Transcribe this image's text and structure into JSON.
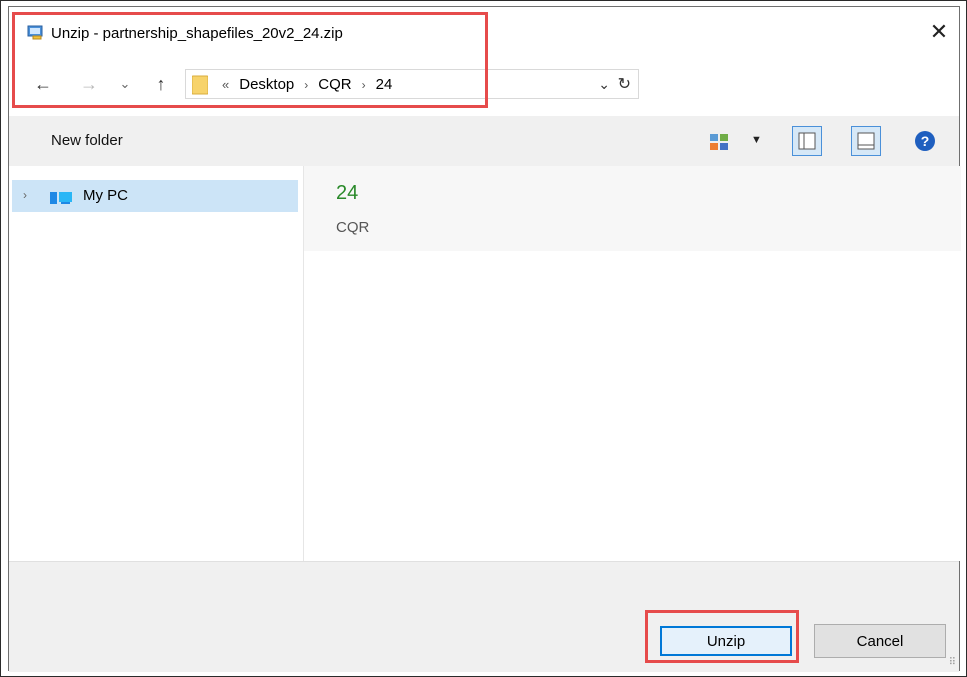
{
  "window": {
    "title": "Unzip - partnership_shapefiles_20v2_24.zip",
    "close_glyph": "✕",
    "title_icon": "unzip-app-icon"
  },
  "nav": {
    "back_glyph": "←",
    "forward_glyph": "→",
    "recent_glyph": "⌄",
    "up_glyph": "↑",
    "overflow_glyph": "«",
    "crumbs": [
      "Desktop",
      "CQR",
      "24"
    ],
    "separator": "›",
    "dropdown_glyph": "⌄",
    "refresh_glyph": "↻"
  },
  "commandbar": {
    "new_folder_label": "New folder",
    "view_drop_glyph": "▼",
    "help_glyph": "?"
  },
  "tree": {
    "items": [
      {
        "label": "My PC",
        "chevron": "›",
        "icon": "computer-icon",
        "selected": true
      }
    ]
  },
  "content": {
    "selected_name": "24",
    "selected_parent": "CQR"
  },
  "footer": {
    "unzip_label": "Unzip",
    "cancel_label": "Cancel",
    "grip_glyph": "⠿"
  },
  "colors": {
    "highlight_red": "#e64b4b",
    "accent_blue": "#0078d7",
    "selection_blue": "#cce4f7",
    "folder_green_text": "#2a8a2a"
  }
}
